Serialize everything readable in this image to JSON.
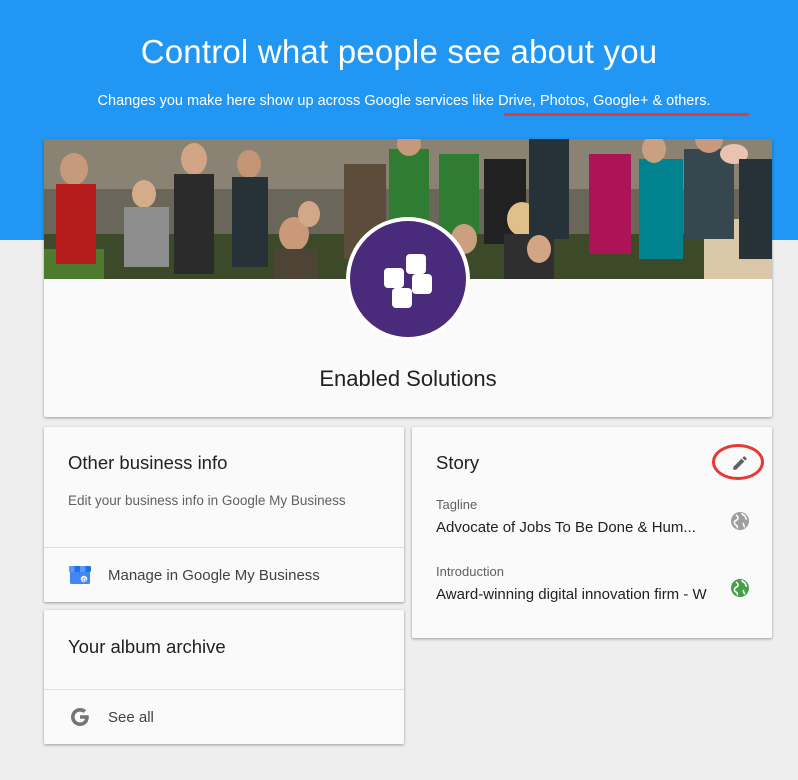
{
  "hero": {
    "title": "Control what people see about you",
    "subtitle": "Changes you make here show up across Google services like Drive, Photos, Google+ & others."
  },
  "profile": {
    "name": "Enabled Solutions",
    "avatar_color": "#4a2a7a"
  },
  "other_business": {
    "title": "Other business info",
    "description": "Edit your business info in Google My Business",
    "action_label": "Manage in Google My Business",
    "action_icon": "google-my-business-icon"
  },
  "album": {
    "title": "Your album archive",
    "action_label": "See all",
    "action_icon": "google-g-icon"
  },
  "story": {
    "title": "Story",
    "edit_icon": "pencil-icon",
    "tagline_label": "Tagline",
    "tagline_value": "Advocate of Jobs To Be Done & Hum...",
    "tagline_visibility_icon": "globe-grey-icon",
    "intro_label": "Introduction",
    "intro_value": "Award-winning digital innovation firm - W",
    "intro_visibility_icon": "globe-green-icon"
  },
  "colors": {
    "hero_blue": "#2196f3",
    "annotation_red": "#e53935",
    "public_green": "#43a047",
    "private_grey": "#9e9e9e"
  }
}
